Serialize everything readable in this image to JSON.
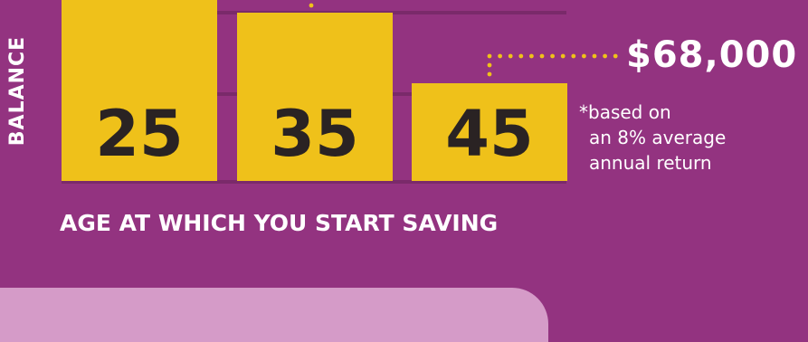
{
  "chart_data": {
    "type": "bar",
    "categories": [
      "25",
      "35",
      "45"
    ],
    "values": [
      null,
      null,
      68000
    ],
    "ylabel": "BALANCE",
    "xlabel": "AGE AT WHICH YOU START SAVING",
    "grid": true,
    "annotations": {
      "value_callout": "$68,000",
      "footnote": [
        "*based on",
        "an 8% average",
        "annual return"
      ]
    }
  },
  "colors": {
    "background": "#933380",
    "bar": "#efc11a",
    "bar_label": "#2a2323",
    "gridline": "#7a2a6a",
    "leader_dots": "#efc11a",
    "text": "#ffffff",
    "bottom_panel": "#d59bc8"
  }
}
